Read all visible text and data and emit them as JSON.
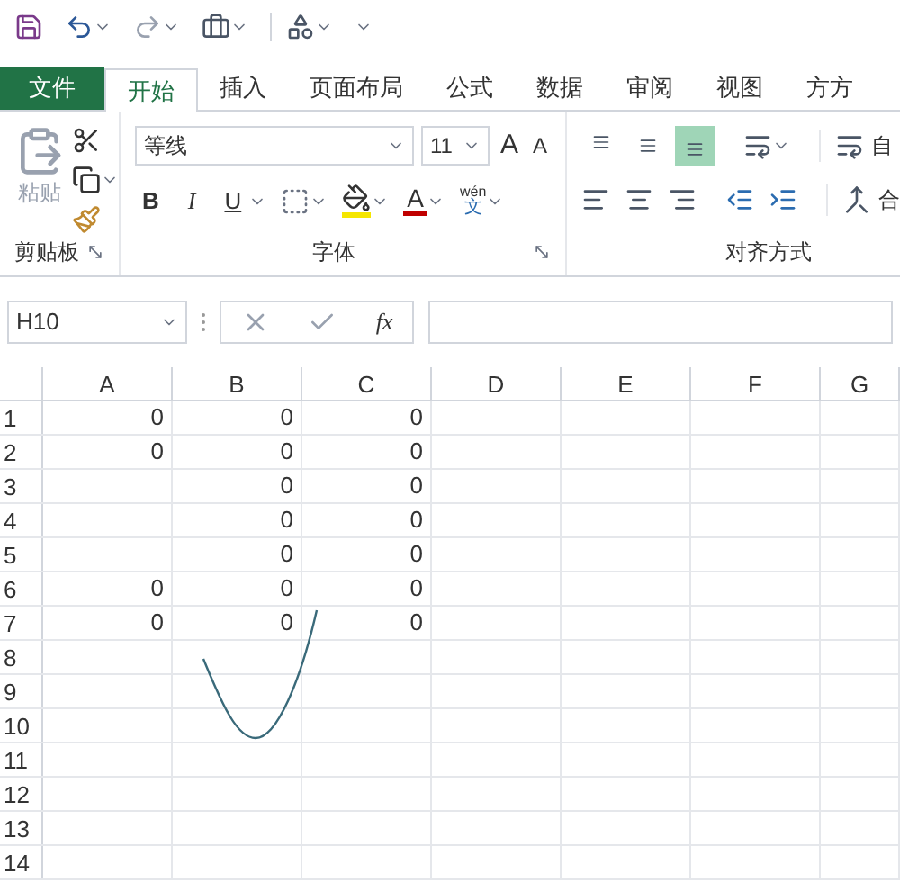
{
  "tabs": [
    {
      "label": "文件",
      "kind": "file",
      "selected": false
    },
    {
      "label": "开始",
      "kind": "tab",
      "selected": true
    },
    {
      "label": "插入",
      "kind": "tab",
      "selected": false
    },
    {
      "label": "页面布局",
      "kind": "tab",
      "selected": false
    },
    {
      "label": "公式",
      "kind": "tab",
      "selected": false
    },
    {
      "label": "数据",
      "kind": "tab",
      "selected": false
    },
    {
      "label": "审阅",
      "kind": "tab",
      "selected": false
    },
    {
      "label": "视图",
      "kind": "tab",
      "selected": false
    },
    {
      "label": "方方",
      "kind": "tab",
      "selected": false
    }
  ],
  "clipboard": {
    "paste": "粘贴",
    "label": "剪贴板"
  },
  "font": {
    "name": "等线",
    "size": "11",
    "grow": "A",
    "shrink": "A",
    "bold": "B",
    "italic": "I",
    "underline": "U",
    "color_letter": "A",
    "phonetic_top": "wén",
    "phonetic_bottom": "文",
    "label": "字体"
  },
  "alignment": {
    "vertical": [
      {
        "kind": "top",
        "selected": false
      },
      {
        "kind": "middle",
        "selected": false
      },
      {
        "kind": "bottom",
        "selected": true
      }
    ],
    "wrap": "自",
    "merge": "合",
    "label": "对齐方式"
  },
  "formula_bar": {
    "name_box": "H10",
    "fx": "fx"
  },
  "sheet": {
    "columns": [
      "A",
      "B",
      "C",
      "D",
      "E",
      "F",
      "G"
    ],
    "rows": [
      {
        "header": "1",
        "cells": [
          "0",
          "0",
          "0",
          null,
          null,
          null,
          null
        ]
      },
      {
        "header": "2",
        "cells": [
          "0",
          "0",
          "0",
          null,
          null,
          null,
          null
        ]
      },
      {
        "header": "3",
        "cells": [
          null,
          "0",
          "0",
          null,
          null,
          null,
          null
        ]
      },
      {
        "header": "4",
        "cells": [
          null,
          "0",
          "0",
          null,
          null,
          null,
          null
        ]
      },
      {
        "header": "5",
        "cells": [
          null,
          "0",
          "0",
          null,
          null,
          null,
          null
        ]
      },
      {
        "header": "6",
        "cells": [
          "0",
          "0",
          "0",
          null,
          null,
          null,
          null
        ]
      },
      {
        "header": "7",
        "cells": [
          "0",
          "0",
          "0",
          null,
          null,
          null,
          null
        ]
      },
      {
        "header": "8",
        "cells": [
          null,
          null,
          null,
          null,
          null,
          null,
          null
        ]
      },
      {
        "header": "9",
        "cells": [
          null,
          null,
          null,
          null,
          null,
          null,
          null
        ]
      },
      {
        "header": "10",
        "cells": [
          null,
          null,
          null,
          null,
          null,
          null,
          null
        ]
      },
      {
        "header": "11",
        "cells": [
          null,
          null,
          null,
          null,
          null,
          null,
          null
        ]
      },
      {
        "header": "12",
        "cells": [
          null,
          null,
          null,
          null,
          null,
          null,
          null
        ]
      },
      {
        "header": "13",
        "cells": [
          null,
          null,
          null,
          null,
          null,
          null,
          null
        ]
      },
      {
        "header": "14",
        "cells": [
          null,
          null,
          null,
          null,
          null,
          null,
          null
        ]
      }
    ]
  }
}
